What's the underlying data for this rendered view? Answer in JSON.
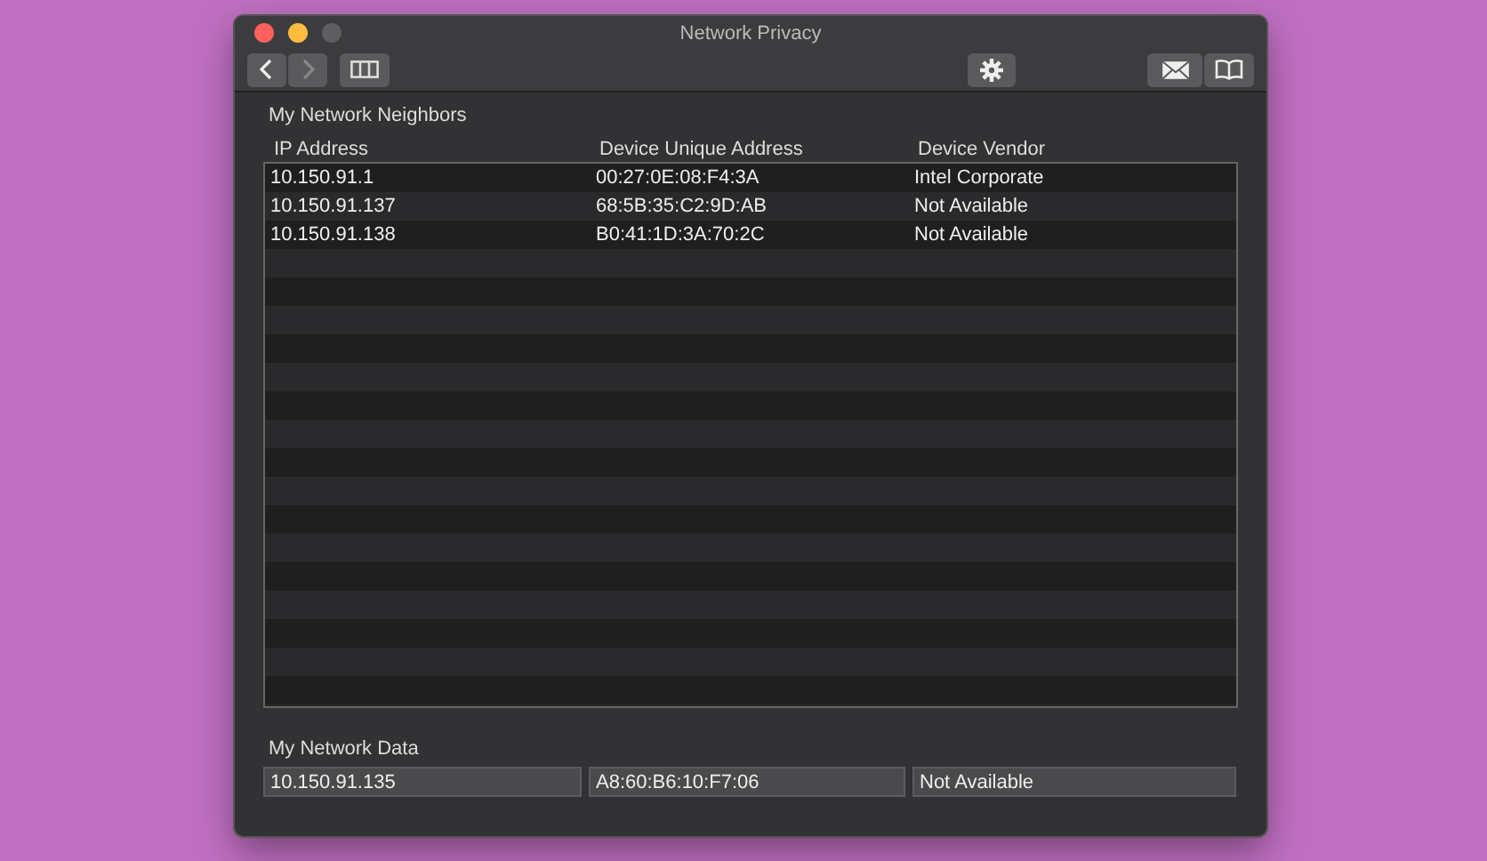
{
  "window": {
    "title": "Network Privacy"
  },
  "toolbar": {
    "back": {
      "disabled": false
    },
    "forward": {
      "disabled": true
    }
  },
  "neighbors": {
    "title": "My Network Neighbors",
    "columns": [
      "IP Address",
      "Device Unique Address",
      "Device Vendor"
    ],
    "rows": [
      [
        "10.150.91.1",
        "00:27:0E:08:F4:3A",
        "Intel Corporate"
      ],
      [
        "10.150.91.137",
        "68:5B:35:C2:9D:AB",
        "Not Available"
      ],
      [
        "10.150.91.138",
        "B0:41:1D:3A:70:2C",
        "Not Available"
      ]
    ]
  },
  "my_data": {
    "title": "My Network Data",
    "fields": [
      "10.150.91.135",
      "A8:60:B6:10:F7:06",
      "Not Available"
    ]
  }
}
